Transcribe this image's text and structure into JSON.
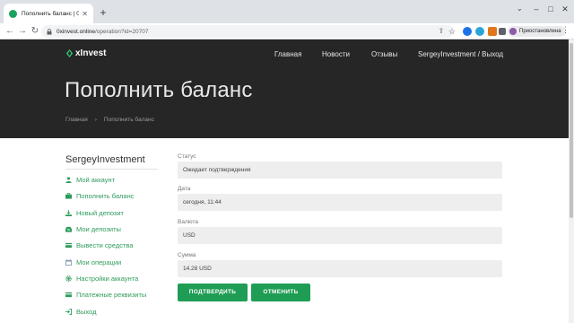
{
  "browser": {
    "tab_title": "Пополнить баланс | 0xInvest",
    "url_host": "0xinvest.online",
    "url_path": "/operation?id=20707",
    "profile_label": "Приостановлена"
  },
  "site": {
    "logo_text": "xInvest",
    "nav": {
      "home": "Главная",
      "news": "Новости",
      "reviews": "Отзывы",
      "account": "SergeyInvestment / Выход"
    },
    "page_title": "Пополнить баланс",
    "breadcrumb": {
      "home": "Главная",
      "separator": "›",
      "current": "Пополнить баланс"
    }
  },
  "sidebar": {
    "username": "SergeyInvestment",
    "items": [
      {
        "label": "Мой аккаунт",
        "icon": "user-icon"
      },
      {
        "label": "Пополнить баланс",
        "icon": "briefcase-icon"
      },
      {
        "label": "Новый депозит",
        "icon": "download-icon"
      },
      {
        "label": "Мои депозиты",
        "icon": "inbox-icon"
      },
      {
        "label": "Вывести средства",
        "icon": "card-icon"
      },
      {
        "label": "Мои операции",
        "icon": "calendar-icon"
      },
      {
        "label": "Настройки аккаунта",
        "icon": "gear-icon"
      },
      {
        "label": "Платежные реквизиты",
        "icon": "card-icon"
      },
      {
        "label": "Выход",
        "icon": "logout-icon"
      }
    ]
  },
  "form": {
    "status_label": "Статус",
    "status_value": "Ожидает подтверждения",
    "date_label": "Дата",
    "date_value": "сегодня, 11:44",
    "currency_label": "Валюта",
    "currency_value": "USD",
    "amount_label": "Сумма",
    "amount_value": "14.28 USD",
    "confirm_label": "ПОДТВЕРДИТЬ",
    "cancel_label": "ОТМЕНИТЬ"
  },
  "colors": {
    "accent": "#1f9d55",
    "header_bg": "#262626",
    "field_bg": "#eeeeee"
  }
}
